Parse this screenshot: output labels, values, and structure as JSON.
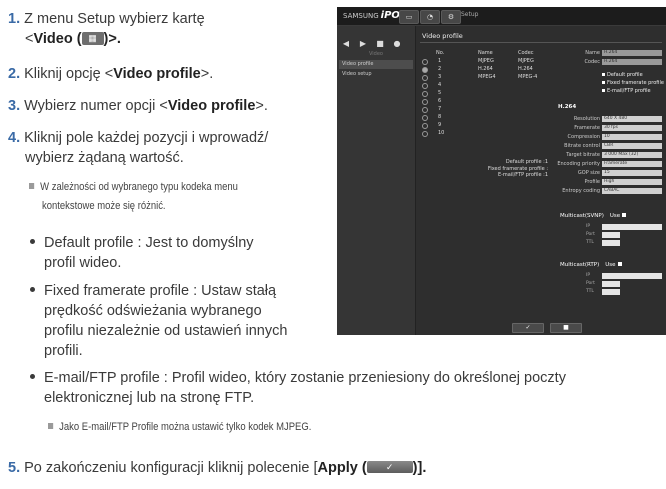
{
  "steps": {
    "s1": {
      "num": "1.",
      "text": "Z menu Setup wybierz kartę",
      "line2_pre": "<",
      "bold": "Video (",
      "icon_glyph": "▦",
      "line2_post": ")>."
    },
    "s2": {
      "num": "2.",
      "pre": "Kliknij opcję <",
      "bold": "Video profile",
      "post": ">."
    },
    "s3": {
      "num": "3.",
      "pre": "Wybierz numer opcji <",
      "bold": "Video profile",
      "post": ">."
    },
    "s4": {
      "num": "4.",
      "line1": "Kliknij pole każdej pozycji i wprowadź/",
      "line2": "wybierz żądaną wartość."
    },
    "note1": {
      "line1": "W zależności od wybranego typu kodeka menu",
      "line2": "kontekstowe może się różnić."
    },
    "b1": {
      "line1": "Default profile : Jest to domyślny",
      "line2": "profil wideo."
    },
    "b2": {
      "line1": "Fixed framerate profile : Ustaw stałą",
      "line2": "prędkość odświeżania wybranego",
      "line3": "profilu niezależnie od ustawień innych",
      "line4": "profili."
    },
    "b3": {
      "line1": "E-mail/FTP profile : Profil wideo, który zostanie przeniesiony do określonej poczty",
      "line2": "elektronicznej lub na stronę FTP."
    },
    "note2": {
      "text": "Jako E-mail/FTP Profile można ustawić tylko kodek MJPEG."
    },
    "s5": {
      "num": "5.",
      "pre": "Po zakończeniu konfiguracji kliknij polecenie [",
      "bold": "Apply (",
      "icon_glyph": "✓",
      "post": ")]."
    }
  },
  "screenshot": {
    "brand_small": "SAMSUNG",
    "brand": "iPOLiS",
    "top_buttons": [
      "▭",
      "◔",
      "⚙"
    ],
    "setup": "Setup",
    "side_icons": [
      "◀",
      "▶",
      "■",
      "●"
    ],
    "side_header": "Video",
    "side_items": [
      "Video profile",
      "Video setup"
    ],
    "title": "Video profile",
    "table_headers": {
      "no": "No.",
      "name": "Name",
      "codec": "Codec"
    },
    "table_rows": [
      {
        "no": "1",
        "name": "MJPEG",
        "codec": "MJPEG"
      },
      {
        "no": "2",
        "name": "H.264",
        "codec": "H.264"
      },
      {
        "no": "3",
        "name": "MPEG4",
        "codec": "MPEG-4"
      },
      {
        "no": "4",
        "name": "",
        "codec": ""
      },
      {
        "no": "5",
        "name": "",
        "codec": ""
      },
      {
        "no": "6",
        "name": "",
        "codec": ""
      },
      {
        "no": "7",
        "name": "",
        "codec": ""
      },
      {
        "no": "8",
        "name": "",
        "codec": ""
      },
      {
        "no": "9",
        "name": "",
        "codec": ""
      },
      {
        "no": "10",
        "name": "",
        "codec": ""
      }
    ],
    "summary": {
      "default": "Default profile :1",
      "fixed": "Fixed framerate profile :",
      "email": "E-mail/FTP profile :1"
    },
    "form": {
      "name_label": "Name",
      "name_value": "H.264",
      "codec_label": "Codec",
      "codec_value": "H.264",
      "chk_default": "Default profile",
      "chk_fixed": "Fixed framerate profile",
      "chk_email": "E-mail/FTP profile",
      "section": "H.264",
      "rows": [
        {
          "label": "Resolution",
          "value": "640 X 480"
        },
        {
          "label": "Framerate",
          "value": "30 fps"
        },
        {
          "label": "Compression",
          "value": "10"
        },
        {
          "label": "Bitrate control",
          "value": "CBR"
        },
        {
          "label": "Target bitrate",
          "value": "3 000 Max (32)"
        },
        {
          "label": "Encoding priority",
          "value": "Framerate"
        },
        {
          "label": "GOP size",
          "value": "15"
        },
        {
          "label": "Profile",
          "value": "High"
        },
        {
          "label": "Entropy coding",
          "value": "CABAC"
        }
      ],
      "mcast1": {
        "title": "Multicast(SVNP)",
        "use": "Use"
      },
      "mcast2": {
        "title": "Multicast(RTP)",
        "use": "Use"
      },
      "ip_label": "IP",
      "port_label": "Port",
      "ttl_label": "TTL"
    },
    "apply_glyph": "✓",
    "cancel_glyph": "■"
  }
}
